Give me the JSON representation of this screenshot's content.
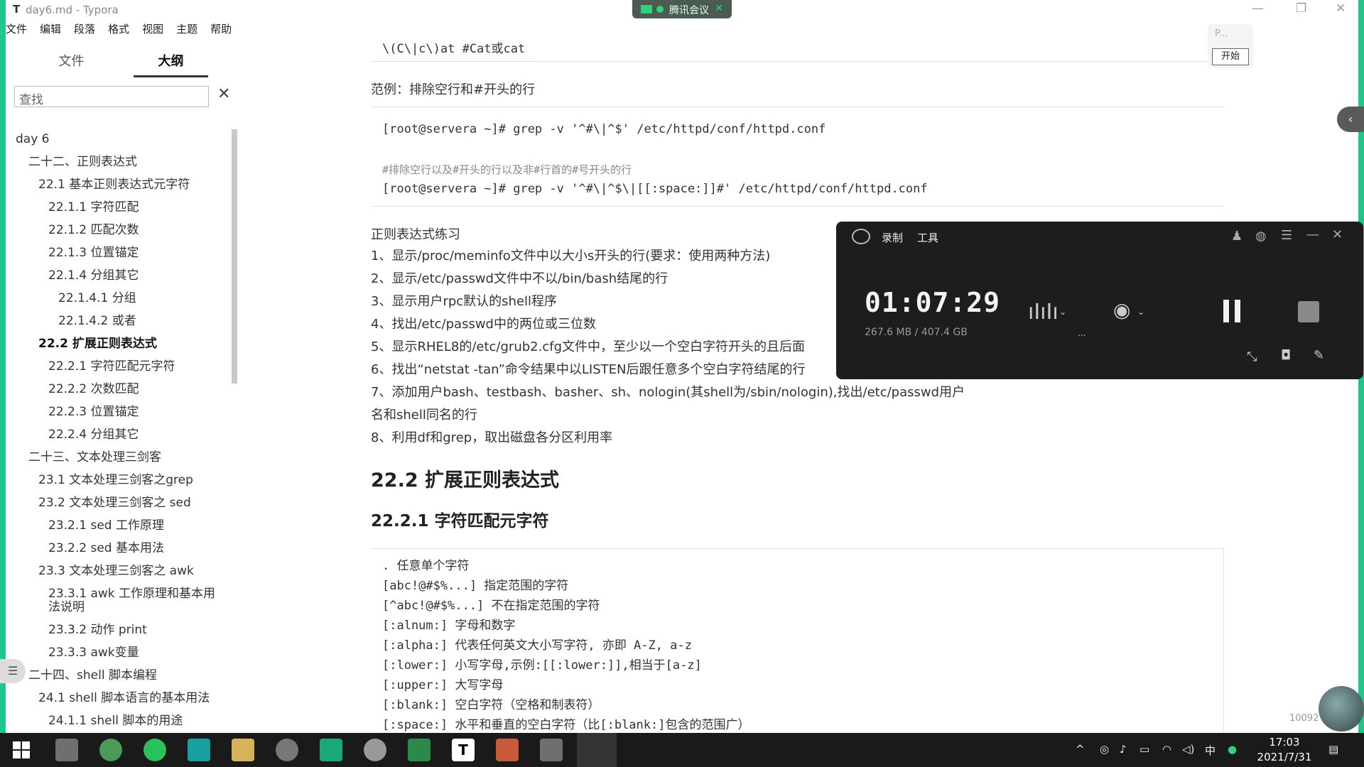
{
  "window": {
    "app_icon": "T",
    "title": "day6.md - Typora",
    "meeting_label": "腾讯会议",
    "minimize": "—",
    "maximize": "❐",
    "close": "✕"
  },
  "menubar": [
    "文件",
    "编辑",
    "段落",
    "格式",
    "视图",
    "主题",
    "帮助"
  ],
  "sidebar": {
    "tabs": [
      "文件",
      "大纲"
    ],
    "active_tab": "大纲",
    "search_value": "查找",
    "close_icon": "✕",
    "outline": [
      {
        "label": "day 6",
        "level": 0
      },
      {
        "label": "二十二、正则表达式",
        "level": 1
      },
      {
        "label": "22.1 基本正则表达式元字符",
        "level": 2
      },
      {
        "label": "22.1.1 字符匹配",
        "level": 3
      },
      {
        "label": "22.1.2 匹配次数",
        "level": 3
      },
      {
        "label": "22.1.3 位置锚定",
        "level": 3
      },
      {
        "label": "22.1.4 分组其它",
        "level": 3
      },
      {
        "label": "22.1.4.1 分组",
        "level": 4
      },
      {
        "label": "22.1.4.2 或者",
        "level": 4
      },
      {
        "label": "22.2 扩展正则表达式",
        "level": 2,
        "active": true
      },
      {
        "label": "22.2.1 字符匹配元字符",
        "level": 3
      },
      {
        "label": "22.2.2 次数匹配",
        "level": 3
      },
      {
        "label": "22.2.3 位置锚定",
        "level": 3
      },
      {
        "label": "22.2.4 分组其它",
        "level": 3
      },
      {
        "label": "二十三、文本处理三剑客",
        "level": 1
      },
      {
        "label": "23.1 文本处理三剑客之grep",
        "level": 2
      },
      {
        "label": "23.2 文本处理三剑客之 sed",
        "level": 2
      },
      {
        "label": "23.2.1 sed 工作原理",
        "level": 3
      },
      {
        "label": "23.2.2 sed 基本用法",
        "level": 3
      },
      {
        "label": "23.3 文本处理三剑客之 awk",
        "level": 2
      },
      {
        "label": "23.3.1 awk 工作原理和基本用",
        "label2": "法说明",
        "level": 3
      },
      {
        "label": "23.3.2 动作 print",
        "level": 3
      },
      {
        "label": "23.3.3 awk变量",
        "level": 3
      },
      {
        "label": "二十四、shell 脚本编程",
        "level": 1
      },
      {
        "label": "24.1 shell 脚本语言的基本用法",
        "level": 2
      },
      {
        "label": "24.1.1 shell 脚本的用途",
        "level": 3
      }
    ],
    "footer_left": "‹",
    "footer_code": "</>",
    "drawer_icon": "☰"
  },
  "doc": {
    "line0": "\\(C\\|c\\)at #Cat或cat",
    "example_heading": "范例：排除空行和#开头的行",
    "cmd1": "[root@servera ~]# grep -v '^#\\|^$' /etc/httpd/conf/httpd.conf",
    "comment2": "#排除空行以及#开头的行以及非#行首的#号开头的行",
    "cmd2": "[root@servera ~]# grep -v '^#\\|^$\\|[[:space:]]#' /etc/httpd/conf/httpd.conf",
    "practice_title": "正则表达式练习",
    "practice": [
      "1、显示/proc/meminfo文件中以大小s开头的行(要求：使用两种方法)",
      "2、显示/etc/passwd文件中不以/bin/bash结尾的行",
      "3、显示用户rpc默认的shell程序",
      "4、找出/etc/passwd中的两位或三位数",
      "5、显示RHEL8的/etc/grub2.cfg文件中，至少以一个空白字符开头的且后面",
      "6、找出“netstat -tan”命令结果中以LISTEN后跟任意多个空白字符结尾的行",
      "7、添加用户bash、testbash、basher、sh、nologin(其shell为/sbin/nologin),找出/etc/passwd用户",
      "名和shell同名的行",
      "8、利用df和grep，取出磁盘各分区利用率"
    ],
    "h2": "22.2 扩展正则表达式",
    "h3": "22.2.1 字符匹配元字符",
    "charclass": [
      ". 任意单个字符",
      "[abc!@#$%...] 指定范围的字符",
      "[^abc!@#$%...] 不在指定范围的字符",
      "[:alnum:] 字母和数字",
      "[:alpha:] 代表任何英文大小写字符, 亦即 A-Z, a-z",
      "[:lower:] 小写字母,示例:[[:lower:]],相当于[a-z]",
      "[:upper:] 大写字母",
      "[:blank:] 空白字符（空格和制表符）",
      "[:space:] 水平和垂直的空白字符（比[:blank:]包含的范围广）"
    ]
  },
  "recorder": {
    "menu": [
      "录制",
      "工具"
    ],
    "time": "01:07:29",
    "size": "267.6 MB / 407.4 GB",
    "dots": "...",
    "minimize": "—",
    "close": "✕"
  },
  "mini_widget": {
    "p_label": "P...",
    "start_label": "开始"
  },
  "side_tab_icon": "‹",
  "corner_number": "10092",
  "taskbar": {
    "tray": [
      "^",
      "中"
    ],
    "time": "17:03",
    "date": "2021/7/31"
  },
  "colors": {
    "frame": "#1ec88a",
    "recorder_bg": "#1d1d1d",
    "taskbar_bg": "#1a1a1a"
  }
}
